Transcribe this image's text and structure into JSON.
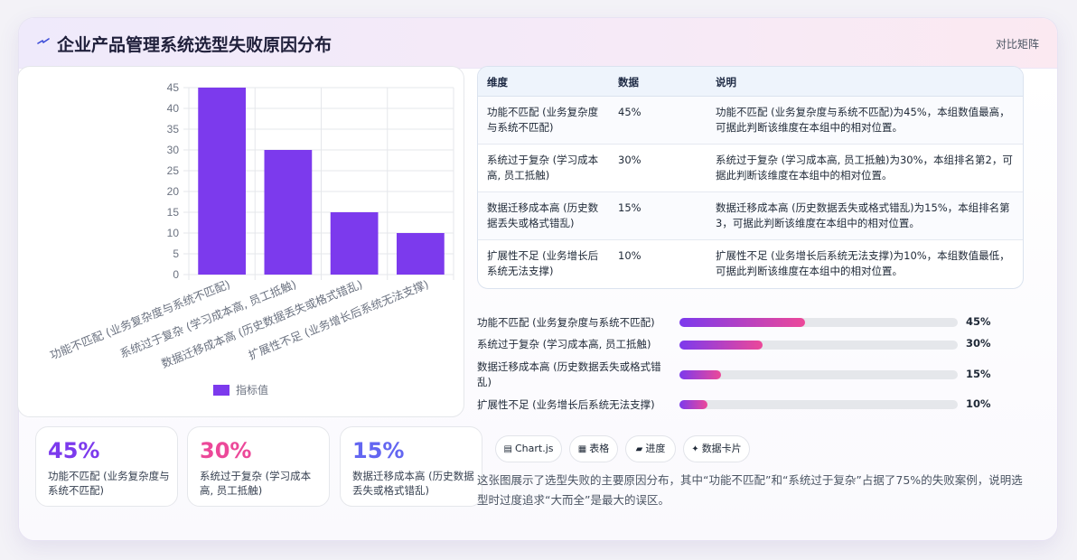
{
  "header": {
    "title": "企业产品管理系统选型失败原因分布",
    "link": "对比矩阵",
    "icon": "lightning-icon"
  },
  "chart_data": {
    "type": "bar",
    "categories": [
      "功能不匹配 (业务复杂度与系统不匹配)",
      "系统过于复杂 (学习成本高, 员工抵触)",
      "数据迁移成本高 (历史数据丢失或格式错乱)",
      "扩展性不足 (业务增长后系统无法支撑)"
    ],
    "series": [
      {
        "name": "指标值",
        "values": [
          45,
          30,
          15,
          10
        ]
      }
    ],
    "yticks": [
      "0",
      "5",
      "10",
      "15",
      "20",
      "25",
      "30",
      "35",
      "40",
      "45"
    ],
    "ylim": [
      0,
      45
    ],
    "grid": true,
    "legend": "bottom",
    "color": "#7c3aed"
  },
  "table": {
    "headers": [
      "维度",
      "数据",
      "说明"
    ],
    "rows": [
      {
        "name": "功能不匹配 (业务复杂度与系统不匹配)",
        "value": "45%",
        "note": "功能不匹配 (业务复杂度与系统不匹配)为45%，本组数值最高，可据此判断该维度在本组中的相对位置。"
      },
      {
        "name": "系统过于复杂 (学习成本高, 员工抵触)",
        "value": "30%",
        "note": "系统过于复杂 (学习成本高, 员工抵触)为30%，本组排名第2，可据此判断该维度在本组中的相对位置。"
      },
      {
        "name": "数据迁移成本高 (历史数据丢失或格式错乱)",
        "value": "15%",
        "note": "数据迁移成本高 (历史数据丢失或格式错乱)为15%，本组排名第3，可据此判断该维度在本组中的相对位置。"
      },
      {
        "name": "扩展性不足 (业务增长后系统无法支撑)",
        "value": "10%",
        "note": "扩展性不足 (业务增长后系统无法支撑)为10%，本组数值最低，可据此判断该维度在本组中的相对位置。"
      }
    ]
  },
  "progress": [
    {
      "label": "功能不匹配 (业务复杂度与系统不匹配)",
      "pct": "45%",
      "fraction": 0.45
    },
    {
      "label": "系统过于复杂 (学习成本高, 员工抵触)",
      "pct": "30%",
      "fraction": 0.3
    },
    {
      "label": "数据迁移成本高 (历史数据丢失或格式错乱)",
      "pct": "15%",
      "fraction": 0.15
    },
    {
      "label": "扩展性不足 (业务增长后系统无法支撑)",
      "pct": "10%",
      "fraction": 0.1
    }
  ],
  "kpis": [
    {
      "value": "45%",
      "label": "功能不匹配 (业务复杂度与系统不匹配)",
      "color": "#7c3aed"
    },
    {
      "value": "30%",
      "label": "系统过于复杂 (学习成本高, 员工抵触)",
      "color": "#ec4899"
    },
    {
      "value": "15%",
      "label": "数据迁移成本高 (历史数据丢失或格式错乱)",
      "color": "#6366f1"
    }
  ],
  "chips": [
    {
      "icon": "chart-icon",
      "glyph": "▤",
      "label": "Chart.js"
    },
    {
      "icon": "table-icon",
      "glyph": "▦",
      "label": "表格"
    },
    {
      "icon": "progress-icon",
      "glyph": "▰",
      "label": "进度"
    },
    {
      "icon": "sparkle-icon",
      "glyph": "✦",
      "label": "数据卡片"
    }
  ],
  "description": "这张图展示了选型失败的主要原因分布，其中“功能不匹配”和“系统过于复杂”占据了75%的失败案例，说明选型时过度追求“大而全”是最大的误区。"
}
